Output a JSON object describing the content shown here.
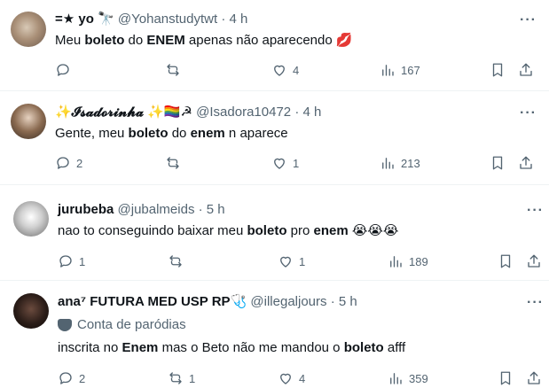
{
  "tweets": [
    {
      "name": "=★ yo 🔭",
      "handle": "@Yohanstudytwt",
      "time": "4 h",
      "text_parts": [
        "Meu ",
        "boleto",
        " do ",
        "ENEM",
        " apenas não aparecendo 💋"
      ],
      "replies": "",
      "retweets": "",
      "likes": "4",
      "views": "167"
    },
    {
      "name": "✨𝓘𝓼𝓪𝓭𝓸𝓻𝓲𝓷𝓱𝓪 ✨🏳️‍🌈☭",
      "handle": "@Isadora10472",
      "time": "4 h",
      "text_parts": [
        "Gente, meu ",
        "boleto",
        " do ",
        "enem",
        " n aparece"
      ],
      "replies": "2",
      "retweets": "",
      "likes": "1",
      "views": "213"
    },
    {
      "name": "jurubeba",
      "handle": "@jubalmeids",
      "time": "5 h",
      "text_parts": [
        "nao to conseguindo baixar meu ",
        "boleto",
        " pro ",
        "enem",
        " 😭😭😭"
      ],
      "replies": "1",
      "retweets": "",
      "likes": "1",
      "views": "189"
    },
    {
      "name": "ana⁷ FUTURA MED USP RP🩺",
      "handle": "@illegaljours",
      "time": "5 h",
      "parody_label": "Conta de paródias",
      "text_parts": [
        "inscrita no ",
        "Enem",
        " mas o Beto não me mandou o ",
        "boleto",
        " afff"
      ],
      "replies": "2",
      "retweets": "1",
      "likes": "4",
      "views": "359"
    }
  ],
  "more_label": "···",
  "colors": {
    "text": "#0f1419",
    "muted": "#536471",
    "divider": "#eff3f4"
  }
}
